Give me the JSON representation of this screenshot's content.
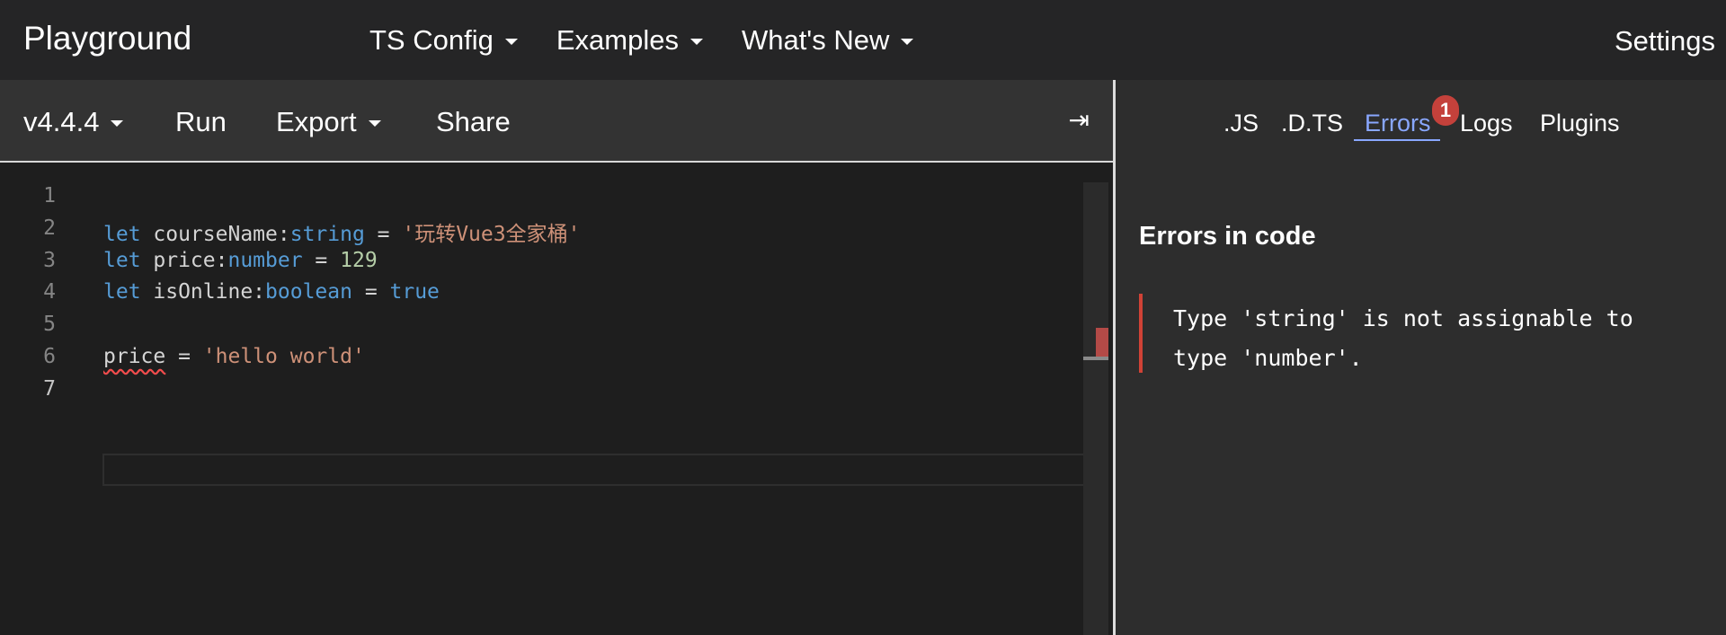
{
  "app": {
    "title": "Playground"
  },
  "nav": {
    "items": [
      {
        "label": "TS Config"
      },
      {
        "label": "Examples"
      },
      {
        "label": "What's New"
      }
    ],
    "settings_label": "Settings"
  },
  "toolbar": {
    "version": "v4.4.4",
    "run": "Run",
    "export": "Export",
    "share": "Share",
    "collapse_glyph": "⇥"
  },
  "editor": {
    "line_numbers": [
      "1",
      "2",
      "3",
      "4",
      "5",
      "6",
      "7"
    ],
    "active_line": "7",
    "lines": [
      {
        "tokens": []
      },
      {
        "tokens": [
          {
            "t": "let",
            "c": "kw"
          },
          {
            "t": " courseName:",
            "c": ""
          },
          {
            "t": "string",
            "c": "ty"
          },
          {
            "t": " = ",
            "c": ""
          },
          {
            "t": "'玩转Vue3全家桶'",
            "c": "str"
          }
        ]
      },
      {
        "tokens": [
          {
            "t": "let",
            "c": "kw"
          },
          {
            "t": " price:",
            "c": ""
          },
          {
            "t": "number",
            "c": "ty"
          },
          {
            "t": " = ",
            "c": ""
          },
          {
            "t": "129",
            "c": "num"
          }
        ]
      },
      {
        "tokens": [
          {
            "t": "let",
            "c": "kw"
          },
          {
            "t": " isOnline:",
            "c": ""
          },
          {
            "t": "boolean",
            "c": "ty"
          },
          {
            "t": " = ",
            "c": ""
          },
          {
            "t": "true",
            "c": "kw"
          }
        ]
      },
      {
        "tokens": []
      },
      {
        "tokens": [
          {
            "t": "price",
            "c": "err-underline"
          },
          {
            "t": " = ",
            "c": ""
          },
          {
            "t": "'hello world'",
            "c": "str"
          }
        ]
      },
      {
        "tokens": []
      }
    ]
  },
  "output": {
    "tabs": [
      {
        "label": ".JS"
      },
      {
        "label": ".D.TS"
      },
      {
        "label": "Errors"
      },
      {
        "label": "Logs"
      },
      {
        "label": "Plugins"
      }
    ],
    "active_tab": "Errors",
    "error_count": "1",
    "errors_title": "Errors in code",
    "errors": [
      "Type 'string' is not assignable to type 'number'."
    ]
  },
  "colors": {
    "accent": "#89a7ff",
    "error": "#d04236",
    "badge": "#c4413b"
  }
}
